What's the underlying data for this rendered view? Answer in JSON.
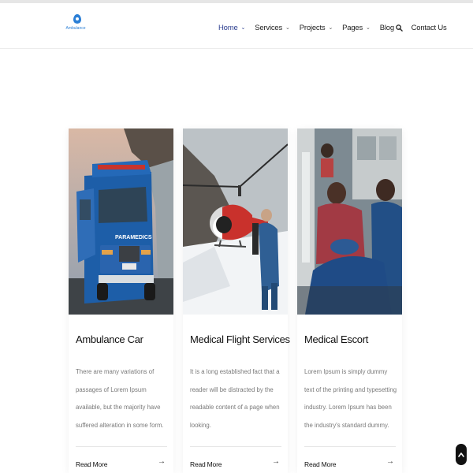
{
  "brand": {
    "name": "Ambulance",
    "color": "#2b7fd6"
  },
  "nav": {
    "items": [
      {
        "label": "Home",
        "active": true,
        "has_dropdown": true
      },
      {
        "label": "Services",
        "active": false,
        "has_dropdown": true
      },
      {
        "label": "Projects",
        "active": false,
        "has_dropdown": true
      },
      {
        "label": "Pages",
        "active": false,
        "has_dropdown": true
      },
      {
        "label": "Blog",
        "active": false,
        "has_dropdown": true
      },
      {
        "label": "Contact Us",
        "active": false,
        "has_dropdown": false
      }
    ],
    "chevron": "⌄",
    "search_icon": "search-icon",
    "active_color": "#2c3e8f"
  },
  "cards": [
    {
      "image": "ambulance-vehicle-photo",
      "image_text": "PARAMEDICS",
      "title": "Ambulance Car",
      "text": "There are many variations of passages of Lorem Ipsum available, but the majority have suffered alteration in some form.",
      "read_more": "Read More",
      "arrow": "→"
    },
    {
      "image": "helicopter-photo",
      "title": "Medical Flight Services",
      "text": "It is a long established fact that a reader will be distracted by the readable content of a page when looking.",
      "read_more": "Read More",
      "arrow": "→"
    },
    {
      "image": "paramedics-patient-photo",
      "title": "Medical Escort",
      "text": "Lorem Ipsum is simply dummy text of the printing and typesetting industry. Lorem Ipsum has been the industry's standard dummy.",
      "read_more": "Read More",
      "arrow": "→"
    }
  ],
  "back_to_top": {
    "icon": "arrow-up-icon",
    "color": "#111111"
  }
}
